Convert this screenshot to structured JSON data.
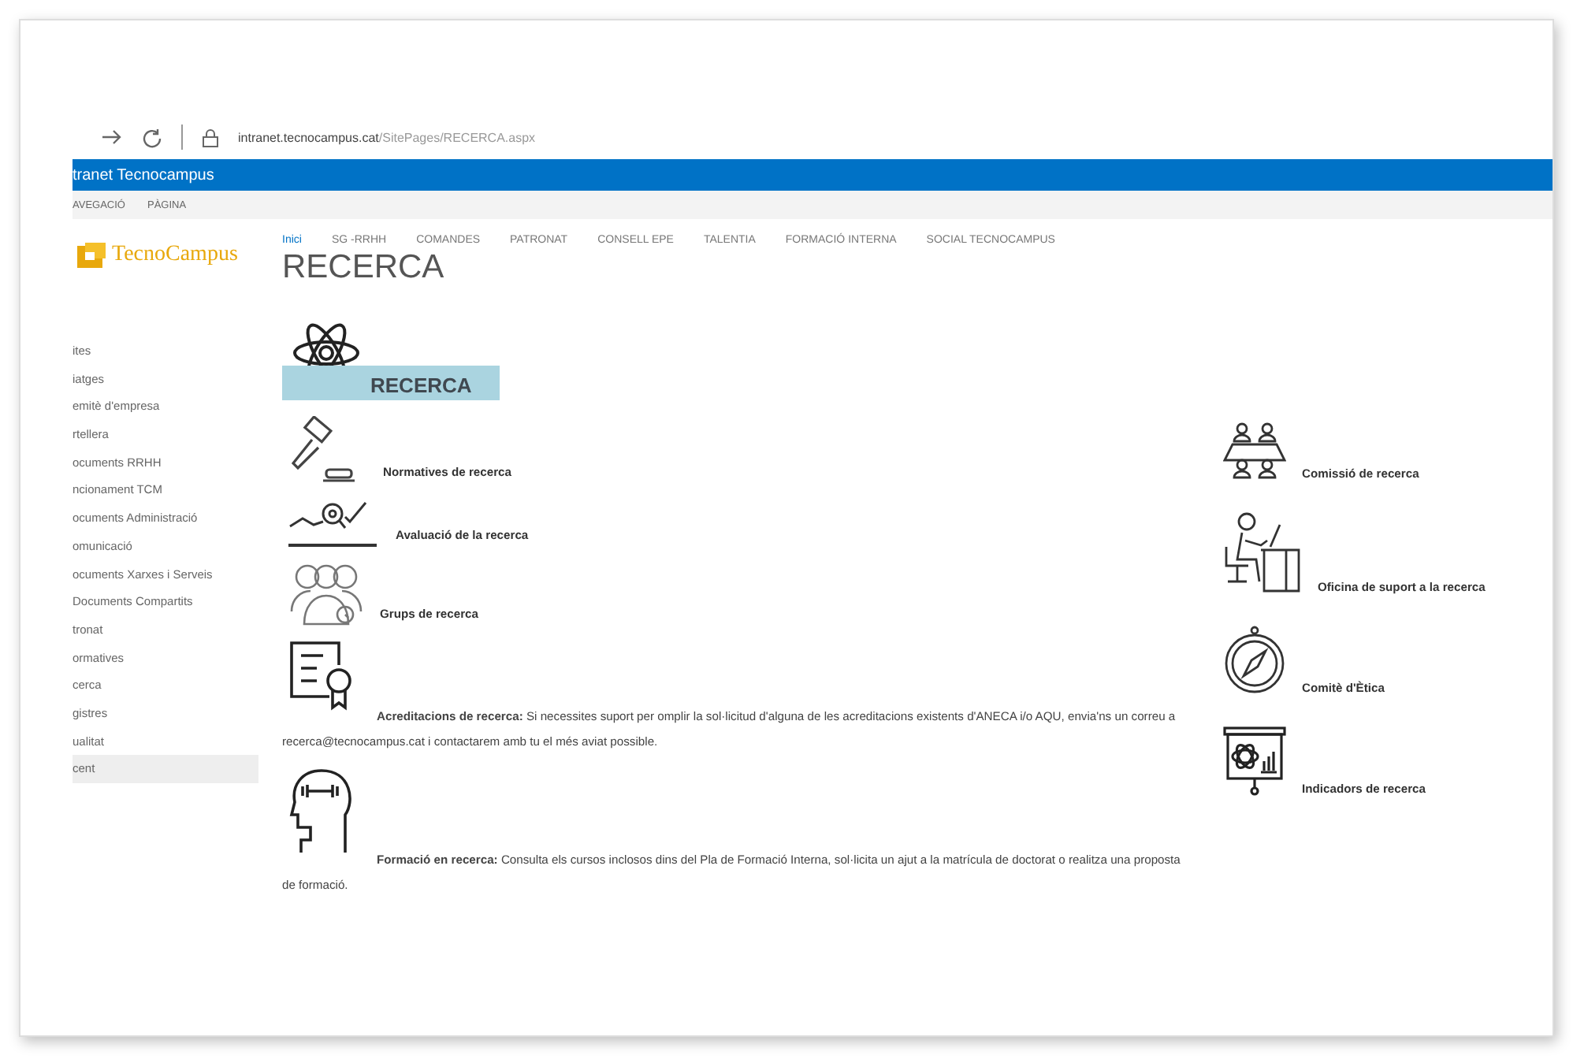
{
  "browser": {
    "url_host": "intranet.tecnocampus.cat",
    "url_path": "/SitePages/RECERCA.aspx"
  },
  "suite_bar": {
    "title": "tranet Tecnocampus"
  },
  "ribbon": {
    "tabs": [
      {
        "label": "AVEGACIÓ",
        "selected": false
      },
      {
        "label": "PÀGINA",
        "selected": false
      }
    ]
  },
  "logo": {
    "text": "TecnoCampus"
  },
  "top_nav": [
    {
      "label": "Inici",
      "selected": true
    },
    {
      "label": "SG -RRHH",
      "selected": false
    },
    {
      "label": "COMANDES",
      "selected": false
    },
    {
      "label": "PATRONAT",
      "selected": false
    },
    {
      "label": "CONSELL EPE",
      "selected": false
    },
    {
      "label": "TALENTIA",
      "selected": false
    },
    {
      "label": "FORMACIÓ INTERNA",
      "selected": false
    },
    {
      "label": "SOCIAL TECNOCAMPUS",
      "selected": false
    }
  ],
  "page_title": "RECERCA",
  "sidebar": {
    "items": [
      {
        "label": "ites",
        "selected": false
      },
      {
        "label": "iatges",
        "selected": false
      },
      {
        "label": "emitè d'empresa",
        "selected": false
      },
      {
        "label": "rtellera",
        "selected": false
      },
      {
        "label": "ocuments RRHH",
        "selected": false
      },
      {
        "label": "ncionament TCM",
        "selected": false
      },
      {
        "label": "ocuments Administració",
        "selected": false
      },
      {
        "label": "omunicació",
        "selected": false
      },
      {
        "label": "ocuments Xarxes i Serveis",
        "selected": false
      },
      {
        "label": "Documents Compartits",
        "selected": false
      },
      {
        "label": "tronat",
        "selected": false
      },
      {
        "label": "ormatives",
        "selected": false
      },
      {
        "label": "cerca",
        "selected": false
      },
      {
        "label": "gistres",
        "selected": false
      },
      {
        "label": "ualitat",
        "selected": false
      },
      {
        "label": "cent",
        "selected": true
      }
    ]
  },
  "banner": {
    "label": "RECERCA"
  },
  "left_links": [
    {
      "kind": "gavel",
      "text": "Normatives de recerca"
    },
    {
      "kind": "chart",
      "text": "Avaluació de la recerca"
    },
    {
      "kind": "group",
      "text": "Grups de recerca"
    },
    {
      "kind": "certificate",
      "text": "**Acreditacions de recerca:** Si necessites suport per omplir la sol·licitud d'alguna de les acreditacions existents d'ANECA i/o AQU, envia'ns un correu a recerca@tecnocampus.cat i contactarem amb tu el més aviat possible."
    },
    {
      "kind": "head",
      "text": "**Formació en recerca:** Consulta els cursos inclosos dins del Pla de Formació Interna, sol·licita un ajut a la matrícula de doctorat o realitza una proposta de formació."
    }
  ],
  "right_links": [
    {
      "kind": "meeting",
      "text": "Comissió de recerca"
    },
    {
      "kind": "desk",
      "text": "Oficina de suport a la recerca"
    },
    {
      "kind": "compass",
      "text": "Comitè d'Ètica"
    },
    {
      "kind": "presentation",
      "text": "Indicadors de recerca"
    }
  ]
}
